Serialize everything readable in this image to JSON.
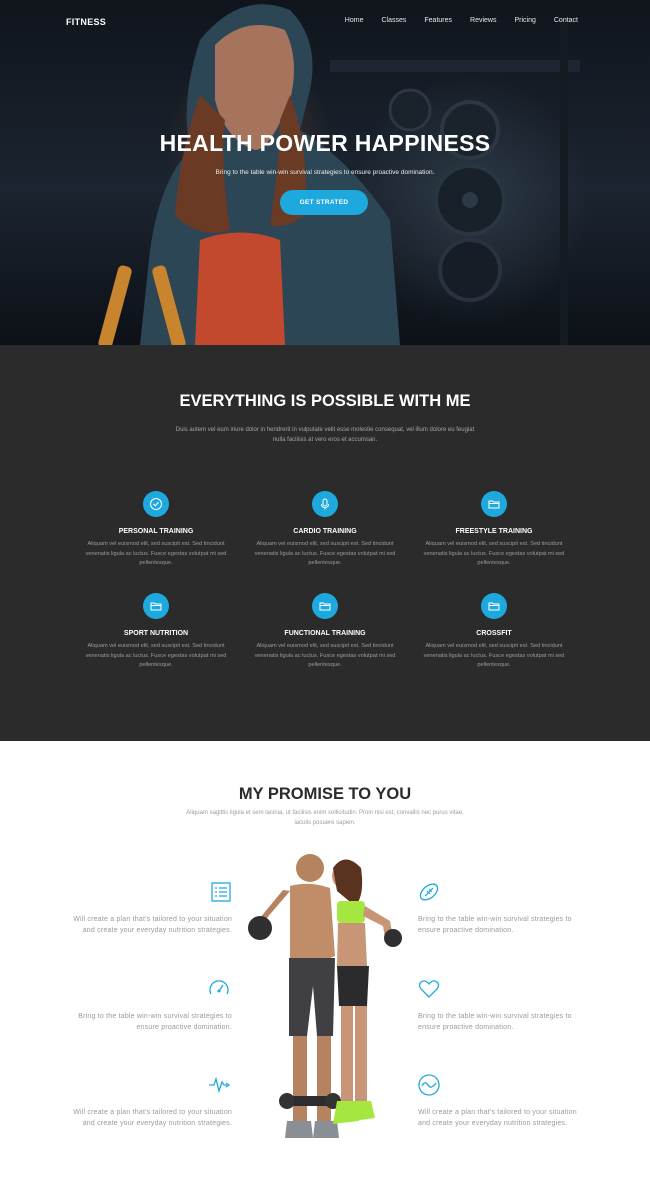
{
  "nav": {
    "logo": "FITNESS",
    "items": [
      "Home",
      "Classes",
      "Features",
      "Reviews",
      "Pricing",
      "Contact"
    ]
  },
  "hero": {
    "title": "HEALTH POWER HAPPINESS",
    "subtitle": "Bring to the table win-win survival strategies to ensure proactive domination.",
    "cta": "GET STRATED"
  },
  "services": {
    "title": "EVERYTHING IS POSSIBLE WITH ME",
    "description": "Duis autem vel eum iriure dolor in hendrerit in vulputate velit esse molestie consequat, vel illum dolore eu feugiat nulla facilisis at vero eros et accumsan.",
    "items": [
      {
        "title": "PERSONAL TRAINING",
        "icon": "check-icon",
        "text": "Aliquam vel euismod elit, sed suscipit est. Sed tincidunt venenatis ligula ac luctus. Fusce egestas volutpat mi sed pellentesque."
      },
      {
        "title": "CARDIO TRAINING",
        "icon": "microphone-icon",
        "text": "Aliquam vel euismod elit, sed suscipit est. Sed tincidunt venenatis ligula ac luctus. Fusce egestas volutpat mi sed pellentesque."
      },
      {
        "title": "FREESTYLE TRAINING",
        "icon": "folder-icon",
        "text": "Aliquam vel euismod elit, sed suscipit est. Sed tincidunt venenatis ligula ac luctus. Fusce egestas volutpat mi sed pellentesque."
      },
      {
        "title": "SPORT NUTRITION",
        "icon": "folder-icon",
        "text": "Aliquam vel euismod elit, sed suscipit est. Sed tincidunt venenatis ligula ac luctus. Fusce egestas volutpat mi sed pellentesque."
      },
      {
        "title": "FUNCTIONAL TRAINING",
        "icon": "folder-icon",
        "text": "Aliquam vel euismod elit, sed suscipit est. Sed tincidunt venenatis ligula ac luctus. Fusce egestas volutpat mi sed pellentesque."
      },
      {
        "title": "CROSSFIT",
        "icon": "folder-icon",
        "text": "Aliquam vel euismod elit, sed suscipit est. Sed tincidunt venenatis ligula ac luctus. Fusce egestas volutpat mi sed pellentesque."
      }
    ]
  },
  "promise": {
    "title": "MY PROMISE TO YOU",
    "description": "Aliquam sagittis ligula et sem lacinia, ut facilisis enim sollicitudin. Proin nisi est, convallis nec purus vitae, iaculis posuere sapien.",
    "features": [
      {
        "icon": "list-icon",
        "text": "Will create a plan that's tailored to your situation and create your everyday nutrition strategies."
      },
      {
        "icon": "football-icon",
        "text": "Bring to the table win-win survival strategies to ensure proactive domination."
      },
      {
        "icon": "speedometer-icon",
        "text": "Bring to the table win-win survival strategies to ensure proactive domination."
      },
      {
        "icon": "heart-icon",
        "text": "Bring to the table win-win survival strategies to ensure proactive domination."
      },
      {
        "icon": "heartbeat-icon",
        "text": "Will create a plan that's tailored to your situation and create your everyday nutrition strategies."
      },
      {
        "icon": "pulse-icon",
        "text": "Will create a plan that's tailored to your situation and create your everyday nutrition strategies."
      }
    ]
  },
  "colors": {
    "accent": "#1da9dd",
    "dark_section": "#2b2b2c",
    "heading_dark": "#2b2b2c",
    "body_gray": "#9a9a9e"
  }
}
